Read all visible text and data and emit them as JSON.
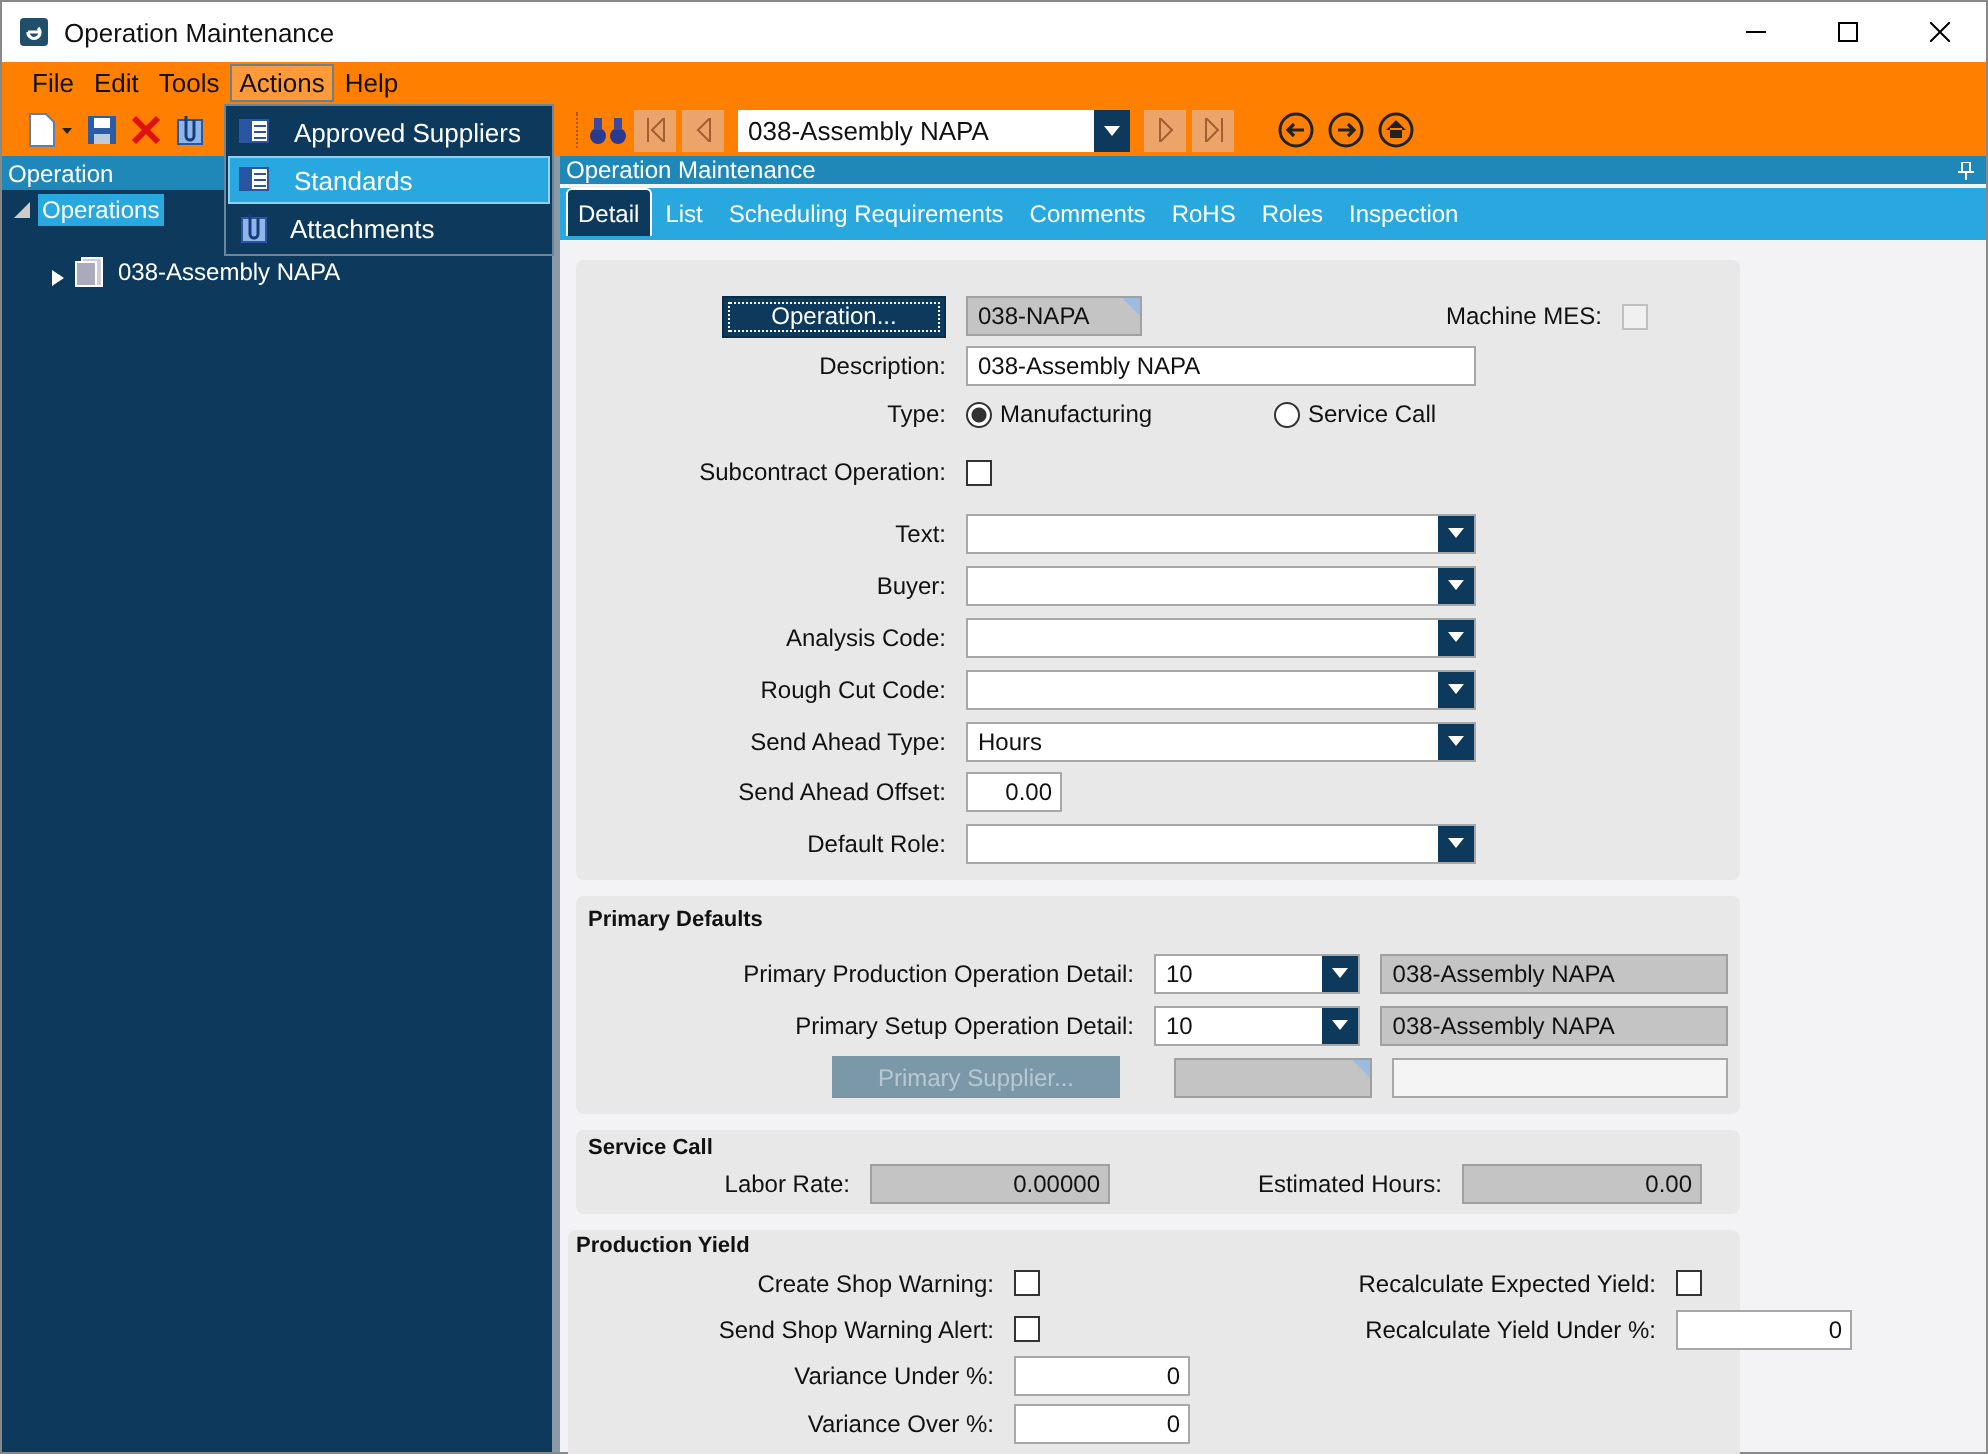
{
  "window": {
    "title": "Operation Maintenance"
  },
  "menu_bar": [
    {
      "label": "File",
      "selected": false
    },
    {
      "label": "Edit",
      "selected": false
    },
    {
      "label": "Tools",
      "selected": false
    },
    {
      "label": "Actions",
      "selected": true
    },
    {
      "label": "Help",
      "selected": false
    }
  ],
  "actions_menu": [
    {
      "label": "Approved Suppliers",
      "selected": false
    },
    {
      "label": "Standards",
      "selected": true
    },
    {
      "label": "Attachments",
      "selected": false
    }
  ],
  "toolbar": {
    "record": "038-Assembly NAPA"
  },
  "navigator": {
    "title": "Operation",
    "tree": [
      {
        "label": "Operations",
        "selected": true,
        "expanded": true,
        "children": [
          {
            "label": "038-Assembly NAPA",
            "selected": false,
            "expanded": false
          }
        ]
      }
    ]
  },
  "main": {
    "title": "Operation Maintenance",
    "tabs": [
      {
        "label": "Detail",
        "selected": true
      },
      {
        "label": "List",
        "selected": false
      },
      {
        "label": "Scheduling Requirements",
        "selected": false
      },
      {
        "label": "Comments",
        "selected": false
      },
      {
        "label": "RoHS",
        "selected": false
      },
      {
        "label": "Roles",
        "selected": false
      },
      {
        "label": "Inspection",
        "selected": false
      }
    ],
    "operation": {
      "button": "Operation...",
      "value": "038-NAPA"
    },
    "machine_mes": {
      "label": "Machine MES:",
      "checked": false,
      "disabled": true
    },
    "fields": [
      {
        "kind": "text",
        "label": "Description:",
        "value": "038-Assembly NAPA"
      },
      {
        "kind": "radio",
        "label": "Type:",
        "options": [
          {
            "label": "Manufacturing",
            "selected": true
          },
          {
            "label": "Service Call",
            "selected": false
          }
        ]
      },
      {
        "kind": "checkbox",
        "label": "Subcontract Operation:",
        "checked": false
      },
      {
        "kind": "dropdown",
        "label": "Text:"
      },
      {
        "kind": "dropdown",
        "label": "Buyer:"
      },
      {
        "kind": "dropdown",
        "label": "Analysis Code:"
      },
      {
        "kind": "dropdown",
        "label": "Rough Cut Code:"
      },
      {
        "kind": "dropdown",
        "label": "Send Ahead Type:",
        "value": "Hours"
      },
      {
        "kind": "number",
        "label": "Send Ahead Offset:",
        "value": "0.00"
      },
      {
        "kind": "dropdown",
        "label": "Default Role:"
      }
    ],
    "primary_defaults": {
      "title": "Primary Defaults",
      "rows": [
        {
          "label": "Primary Production Operation Detail:",
          "value": "10",
          "description": "038-Assembly NAPA"
        },
        {
          "label": "Primary Setup Operation Detail:",
          "value": "10",
          "description": "038-Assembly NAPA"
        }
      ],
      "supplier_button": {
        "label": "Primary Supplier...",
        "disabled": true
      }
    },
    "service_call": {
      "title": "Service Call",
      "fields": [
        {
          "label": "Labor Rate:",
          "value": "0.00000"
        },
        {
          "label": "Estimated Hours:",
          "value": "0.00"
        }
      ]
    },
    "production_yield": {
      "title": "Production Yield",
      "left": [
        {
          "kind": "checkbox",
          "label": "Create Shop Warning:",
          "checked": false
        },
        {
          "kind": "checkbox",
          "label": "Send Shop Warning Alert:",
          "checked": false
        },
        {
          "kind": "number",
          "label": "Variance Under %:",
          "value": "0"
        },
        {
          "kind": "number",
          "label": "Variance Over %:",
          "value": "0"
        }
      ],
      "right": [
        {
          "kind": "checkbox",
          "label": "Recalculate Expected Yield:",
          "checked": false
        },
        {
          "kind": "number",
          "label": "Recalculate Yield Under %:",
          "value": "0"
        }
      ]
    }
  }
}
